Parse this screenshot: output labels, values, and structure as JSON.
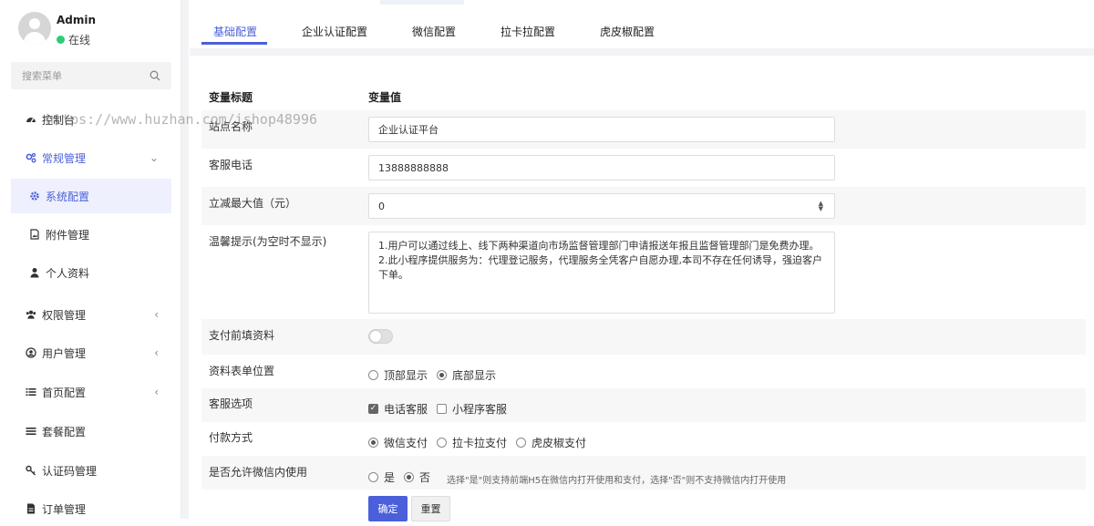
{
  "user": {
    "name": "Admin",
    "status": "在线"
  },
  "search": {
    "placeholder": "搜索菜单"
  },
  "menu": {
    "dashboard": "控制台",
    "general": "常规管理",
    "system_config": "系统配置",
    "attachments": "附件管理",
    "profile": "个人资料",
    "permissions": "权限管理",
    "users": "用户管理",
    "home_config": "首页配置",
    "packages": "套餐配置",
    "auth_codes": "认证码管理",
    "orders": "订单管理"
  },
  "tabs": [
    "基础配置",
    "企业认证配置",
    "微信配置",
    "拉卡拉配置",
    "虎皮椒配置"
  ],
  "table": {
    "col_title": "变量标题",
    "col_value": "变量值"
  },
  "fields": {
    "site_name": {
      "label": "站点名称",
      "value": "企业认证平台"
    },
    "phone": {
      "label": "客服电话",
      "value": "13888888888"
    },
    "max_discount": {
      "label": "立减最大值（元）",
      "value": "0"
    },
    "tips": {
      "label": "温馨提示(为空时不显示)",
      "value": "1.用户可以通过线上、线下两种渠道向市场监督管理部门申请报送年报且监督管理部门是免费办理。2.此小程序提供服务为：代理登记服务，代理服务全凭客户自愿办理,本司不存在任何诱导，强迫客户下单。"
    },
    "prefill": {
      "label": "支付前填资料",
      "enabled": false
    },
    "form_position": {
      "label": "资料表单位置",
      "options": [
        "顶部显示",
        "底部显示"
      ],
      "selected": "底部显示"
    },
    "service_options": {
      "label": "客服选项",
      "options": [
        "电话客服",
        "小程序客服"
      ],
      "checked": [
        "电话客服"
      ]
    },
    "payment": {
      "label": "付款方式",
      "options": [
        "微信支付",
        "拉卡拉支付",
        "虎皮椒支付"
      ],
      "selected": "微信支付"
    },
    "wechat_use": {
      "label": "是否允许微信内使用",
      "options": [
        "是",
        "否"
      ],
      "selected": "否",
      "hint": "选择\"是\"则支持前端H5在微信内打开使用和支付，选择\"否\"则不支持微信内打开使用"
    }
  },
  "buttons": {
    "submit": "确定",
    "reset": "重置"
  },
  "watermark": "https://www.huzhan.com/ishop48996",
  "colors": {
    "accent": "#4a5fd9",
    "online": "#2ecc71"
  }
}
